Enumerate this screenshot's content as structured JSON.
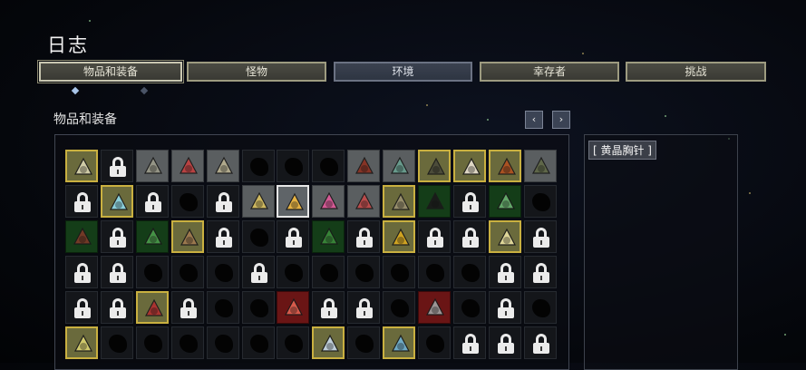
{
  "header": {
    "title": "日志"
  },
  "tabs": [
    {
      "label": "物品和装备",
      "state": "selected"
    },
    {
      "label": "怪物",
      "state": "normal"
    },
    {
      "label": "环境",
      "state": "active"
    },
    {
      "label": "幸存者",
      "state": "normal"
    },
    {
      "label": "挑战",
      "state": "normal"
    }
  ],
  "section": {
    "title": "物品和装备",
    "prev_label": "‹",
    "next_label": "›"
  },
  "detail": {
    "item_name": "[ 黄晶胸针 ]"
  },
  "colors": {
    "gold_border": "#c9b040",
    "locked": "#ebebeb",
    "rare_red": "#6a1515",
    "green": "#143d18"
  },
  "grid": {
    "columns": 14,
    "rows": [
      [
        {
          "state": "golden",
          "icon": "syringe-icon"
        },
        {
          "state": "locked"
        },
        {
          "state": "owned",
          "icon": "horns-icon"
        },
        {
          "state": "owned",
          "icon": "glasses-icon"
        },
        {
          "state": "owned",
          "icon": "bandage-icon"
        },
        {
          "state": "unknown"
        },
        {
          "state": "unknown"
        },
        {
          "state": "unknown"
        },
        {
          "state": "owned",
          "icon": "fist-icon"
        },
        {
          "state": "owned",
          "icon": "leaf-icon"
        },
        {
          "state": "golden",
          "icon": "helmet-icon"
        },
        {
          "state": "golden",
          "icon": "medkit-icon"
        },
        {
          "state": "golden",
          "icon": "wallet-icon"
        },
        {
          "state": "owned",
          "icon": "battery-icon"
        }
      ],
      [
        {
          "state": "locked"
        },
        {
          "state": "golden",
          "icon": "canister-icon"
        },
        {
          "state": "locked"
        },
        {
          "state": "unknown"
        },
        {
          "state": "locked"
        },
        {
          "state": "owned",
          "icon": "scissors-icon"
        },
        {
          "state": "selected",
          "icon": "brooch-icon"
        },
        {
          "state": "owned",
          "icon": "gem-icon"
        },
        {
          "state": "owned",
          "icon": "steak-icon"
        },
        {
          "state": "golden",
          "icon": "hook-icon"
        },
        {
          "state": "green",
          "icon": "card-icon"
        },
        {
          "state": "locked"
        },
        {
          "state": "green",
          "icon": "feather-icon"
        },
        {
          "state": "unknown"
        }
      ],
      [
        {
          "state": "green",
          "icon": "chest-icon"
        },
        {
          "state": "locked"
        },
        {
          "state": "green",
          "icon": "spiral-icon"
        },
        {
          "state": "golden",
          "icon": "box-icon"
        },
        {
          "state": "locked"
        },
        {
          "state": "unknown"
        },
        {
          "state": "locked"
        },
        {
          "state": "green",
          "icon": "vine-icon"
        },
        {
          "state": "locked"
        },
        {
          "state": "golden",
          "icon": "coin-icon"
        },
        {
          "state": "locked"
        },
        {
          "state": "locked"
        },
        {
          "state": "golden",
          "icon": "potion-icon"
        },
        {
          "state": "locked"
        }
      ],
      [
        {
          "state": "locked"
        },
        {
          "state": "locked"
        },
        {
          "state": "unknown"
        },
        {
          "state": "unknown"
        },
        {
          "state": "unknown"
        },
        {
          "state": "locked"
        },
        {
          "state": "unknown"
        },
        {
          "state": "unknown"
        },
        {
          "state": "unknown"
        },
        {
          "state": "unknown"
        },
        {
          "state": "unknown"
        },
        {
          "state": "unknown"
        },
        {
          "state": "locked"
        },
        {
          "state": "locked"
        }
      ],
      [
        {
          "state": "locked"
        },
        {
          "state": "locked"
        },
        {
          "state": "golden",
          "icon": "heart-icon"
        },
        {
          "state": "locked"
        },
        {
          "state": "unknown"
        },
        {
          "state": "unknown"
        },
        {
          "state": "red",
          "icon": "cluster-icon"
        },
        {
          "state": "locked"
        },
        {
          "state": "locked"
        },
        {
          "state": "unknown"
        },
        {
          "state": "red",
          "icon": "hammer-icon"
        },
        {
          "state": "unknown"
        },
        {
          "state": "locked"
        },
        {
          "state": "unknown"
        }
      ],
      [
        {
          "state": "golden",
          "icon": "orb-icon"
        },
        {
          "state": "unknown"
        },
        {
          "state": "unknown"
        },
        {
          "state": "unknown"
        },
        {
          "state": "unknown"
        },
        {
          "state": "unknown"
        },
        {
          "state": "unknown"
        },
        {
          "state": "golden",
          "icon": "horn-icon"
        },
        {
          "state": "unknown"
        },
        {
          "state": "golden",
          "icon": "fish-icon"
        },
        {
          "state": "unknown"
        },
        {
          "state": "locked"
        },
        {
          "state": "locked"
        },
        {
          "state": "locked"
        }
      ]
    ]
  }
}
